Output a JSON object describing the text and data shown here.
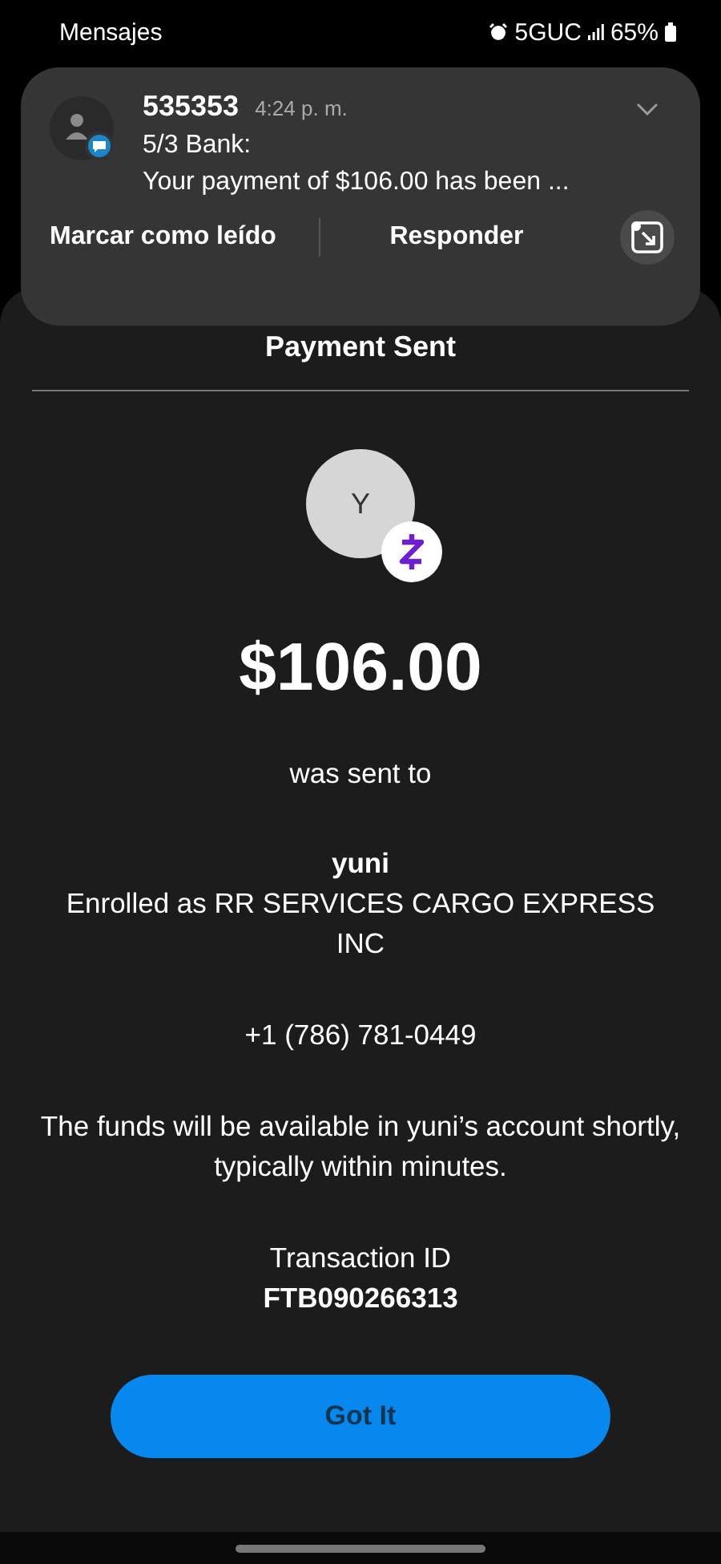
{
  "status_bar": {
    "app": "Mensajes",
    "network": "5GUC",
    "battery": "65%"
  },
  "notification": {
    "sender": "535353",
    "time": "4:24 p. m.",
    "title": "5/3 Bank:",
    "body": "Your payment of $106.00 has been ...",
    "actions": [
      "Marcar como leído",
      "Responder"
    ]
  },
  "sheet": {
    "title": "Payment Sent",
    "avatar_initial": "Y",
    "amount": "$106.00",
    "sent_label": "was sent to",
    "recipient": "yuni",
    "enrolled": "Enrolled as RR SERVICES CARGO EXPRESS INC",
    "phone": "+1 (786) 781-0449",
    "note": "The funds will be available in yuni’s account shortly, typically within minutes.",
    "transaction_label": "Transaction ID",
    "transaction_id": "FTB090266313",
    "button": "Got It"
  }
}
